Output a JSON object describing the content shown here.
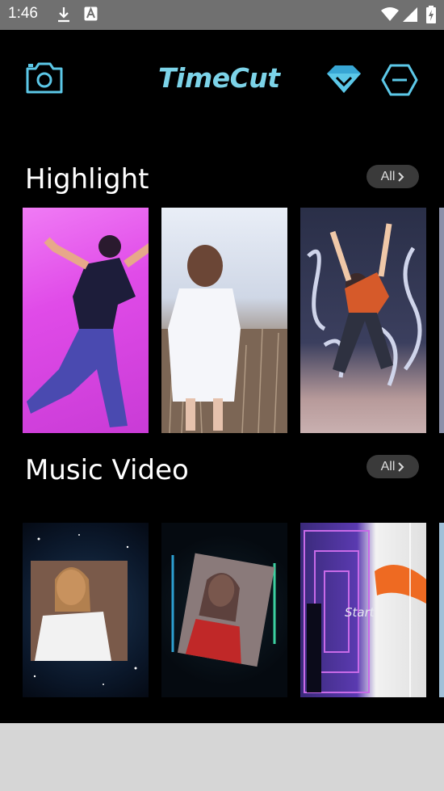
{
  "status_bar": {
    "time": "1:46"
  },
  "header": {
    "logo_text": "TimeCut",
    "camera_icon": "camera-icon",
    "premium_icon": "diamond-icon",
    "menu_icon": "hexagon-minus-icon"
  },
  "sections": {
    "highlight": {
      "title": "Highlight",
      "all_label": "All"
    },
    "music_video": {
      "title": "Music Video",
      "all_label": "All",
      "thumb_overlay_text": "Start"
    }
  },
  "colors": {
    "accent": "#5cc8e8",
    "background": "#000000",
    "status_bar": "#707070",
    "pill": "#3a3a3a"
  }
}
